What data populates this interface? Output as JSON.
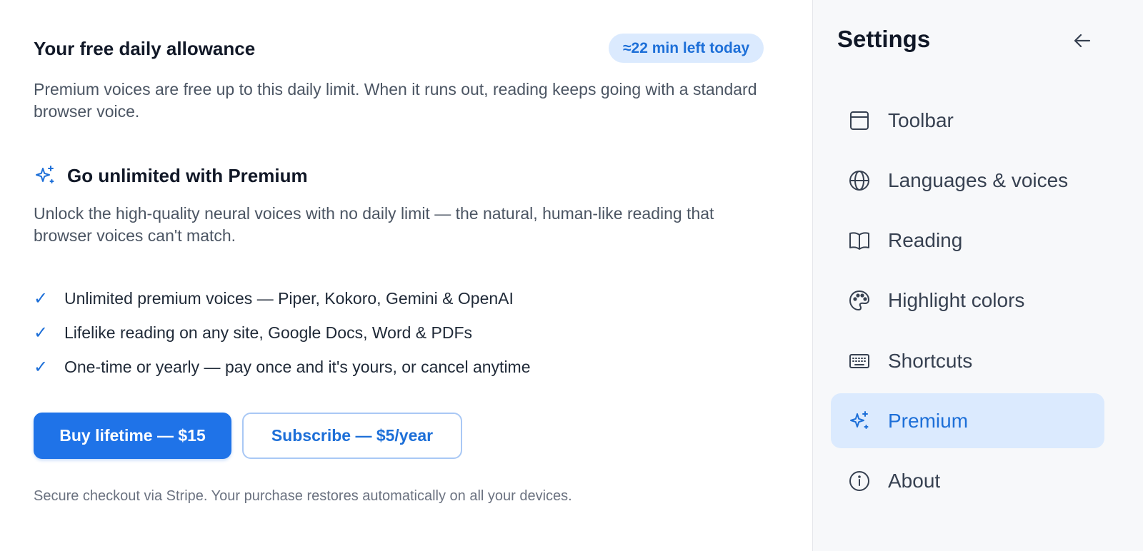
{
  "allowance": {
    "title": "Your free daily allowance",
    "badge": "≈22 min left today",
    "description": "Premium voices are free up to this daily limit. When it runs out, reading keeps going with a standard browser voice."
  },
  "premium": {
    "title": "Go unlimited with Premium",
    "description": "Unlock the high-quality neural voices with no daily limit — the natural, human-like reading that browser voices can't match.",
    "check_mark": "✓",
    "features": [
      "Unlimited premium voices — Piper, Kokoro, Gemini & OpenAI",
      "Lifelike reading on any site, Google Docs, Word & PDFs",
      "One-time or yearly — pay once and it's yours, or cancel anytime"
    ],
    "buy_label": "Buy lifetime — $15",
    "subscribe_label": "Subscribe — $5/year",
    "note": "Secure checkout via Stripe. Your purchase restores automatically on all your devices."
  },
  "sidebar": {
    "title": "Settings",
    "back_icon": "arrow-left-icon",
    "items": [
      {
        "label": "Toolbar",
        "icon": "toolbar-icon"
      },
      {
        "label": "Languages & voices",
        "icon": "globe-icon"
      },
      {
        "label": "Reading",
        "icon": "book-icon"
      },
      {
        "label": "Highlight colors",
        "icon": "palette-icon"
      },
      {
        "label": "Shortcuts",
        "icon": "keyboard-icon"
      },
      {
        "label": "Premium",
        "icon": "sparkles-icon",
        "active": true
      },
      {
        "label": "About",
        "icon": "info-icon"
      }
    ]
  },
  "colors": {
    "accent": "#1f73e8",
    "accent_text": "#1d6fd8",
    "active_bg": "#dbeafe",
    "sidebar_bg": "#f7f8fa"
  }
}
